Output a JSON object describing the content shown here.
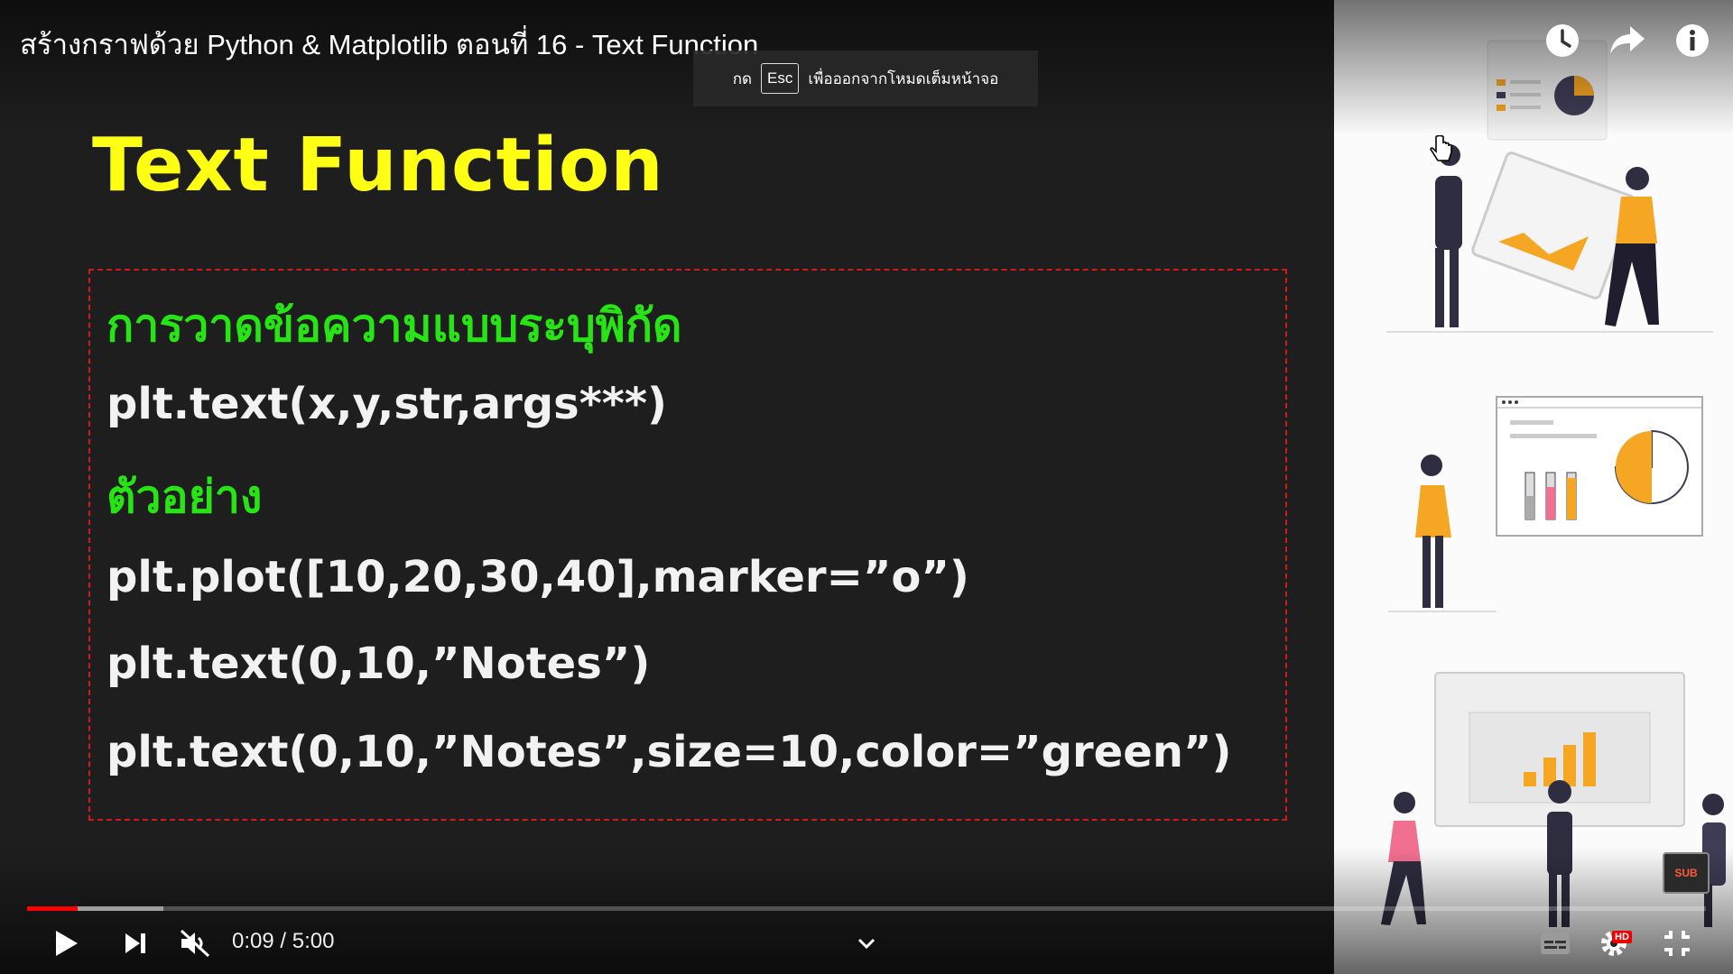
{
  "video": {
    "title": "สร้างกราฟด้วย Python & Matplotlib ตอนที่ 16 - Text Function",
    "fullscreen_toast": {
      "prefix": "กด",
      "key": "Esc",
      "suffix": "เพื่อออกจากโหมดเต็มหน้าจอ"
    },
    "top_icons": [
      "clock-icon",
      "share-icon",
      "info-icon"
    ]
  },
  "slide": {
    "title": "Text Function",
    "lines": [
      {
        "text": "การวาดข้อความแบบระบุพิกัด",
        "style": "green"
      },
      {
        "text": "plt.text(x,y,str,args***)",
        "style": "white"
      },
      {
        "text": "ตัวอย่าง",
        "style": "green"
      },
      {
        "text": "plt.plot([10,20,30,40],marker=”o”)",
        "style": "white"
      },
      {
        "text": "plt.text(0,10,”Notes”)",
        "style": "white"
      },
      {
        "text": "plt.text(0,10,”Notes”,size=10,color=”green”)",
        "style": "white"
      }
    ]
  },
  "player": {
    "current_time": "0:09",
    "separator": "/",
    "duration": "5:00",
    "time_display": "0:09 / 5:00",
    "played_fraction": 0.03,
    "buffered_fraction": 0.081,
    "hd_label": "HD",
    "sub_label": "SUB"
  },
  "colors": {
    "title_yellow": "#ffff14",
    "thai_green": "#27e414",
    "box_red": "#d01b1b",
    "progress_red": "#ff0000",
    "accent_orange": "#f5a623"
  }
}
